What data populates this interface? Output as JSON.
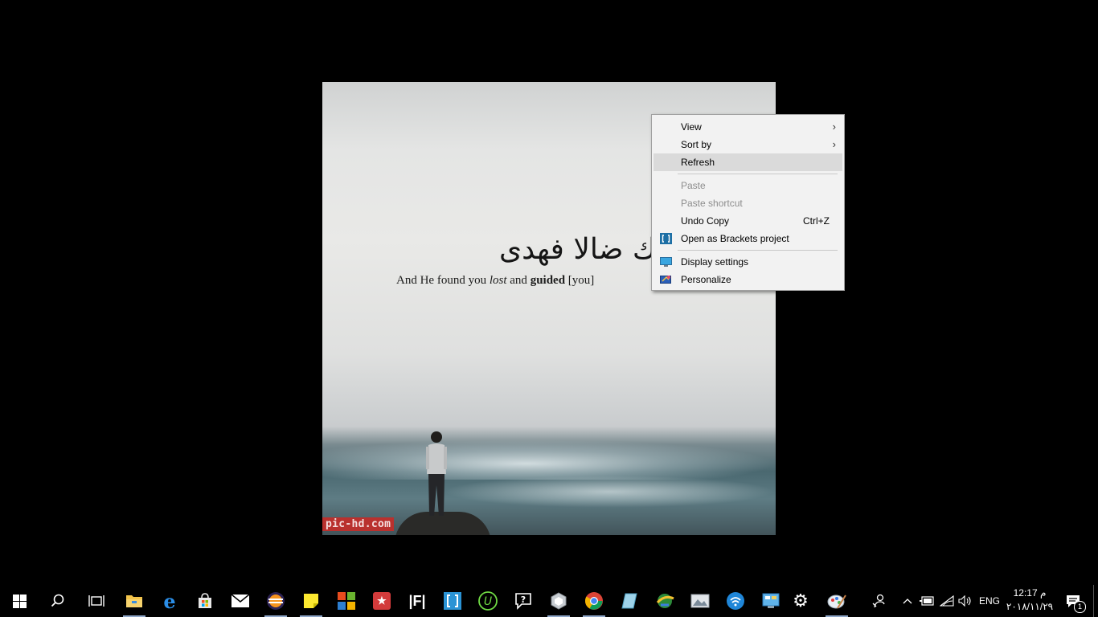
{
  "wallpaper": {
    "arabic_text": "ووجدك ضالا فهدى",
    "english_prefix": "And He found you",
    "english_lost": "lost",
    "english_and": "and",
    "english_guided": "guided",
    "english_suffix": "[you]",
    "watermark": "pic-hd.com"
  },
  "context_menu": {
    "items": [
      {
        "label": "View",
        "submenu": true
      },
      {
        "label": "Sort by",
        "submenu": true
      },
      {
        "label": "Refresh",
        "highlighted": true
      },
      {
        "label": "Paste",
        "disabled": true
      },
      {
        "label": "Paste shortcut",
        "disabled": true
      },
      {
        "label": "Undo Copy",
        "shortcut": "Ctrl+Z"
      },
      {
        "label": "Open as Brackets project",
        "icon": "brackets-icon"
      },
      {
        "label": "Display settings",
        "icon": "display-icon"
      },
      {
        "label": "Personalize",
        "icon": "personalize-icon"
      }
    ]
  },
  "taskbar": {
    "apps": [
      {
        "name": "file-explorer-icon",
        "running": true
      },
      {
        "name": "edge-icon",
        "running": false
      },
      {
        "name": "store-icon",
        "running": false
      },
      {
        "name": "mail-icon",
        "running": false
      },
      {
        "name": "eclipse-icon",
        "running": true
      },
      {
        "name": "sticky-notes-icon",
        "running": true
      },
      {
        "name": "office-icon",
        "running": false
      },
      {
        "name": "wunderlist-icon",
        "running": false
      },
      {
        "name": "fl-icon",
        "running": false
      },
      {
        "name": "brackets-icon",
        "running": false
      },
      {
        "name": "upwork-icon",
        "running": false
      },
      {
        "name": "feedback-icon",
        "running": false
      },
      {
        "name": "shield-icon",
        "running": true
      },
      {
        "name": "chrome-icon",
        "running": true
      },
      {
        "name": "notes-icon",
        "running": false
      },
      {
        "name": "internet-download-icon",
        "running": false
      },
      {
        "name": "photos-icon",
        "running": false
      },
      {
        "name": "wifi-app-icon",
        "running": false
      },
      {
        "name": "control-panel-icon",
        "running": false
      },
      {
        "name": "settings-icon",
        "running": false
      },
      {
        "name": "paint-icon",
        "running": true
      }
    ],
    "tray_language": "ENG",
    "clock_time": "12:17 م",
    "clock_date": "٢٠١٨/١١/٢٩",
    "notification_count": "1"
  },
  "colors": {
    "taskbar_bg": "#000000",
    "menu_bg": "#f2f2f2",
    "menu_highlight": "#dadada",
    "watermark_bg": "#b9312e"
  }
}
